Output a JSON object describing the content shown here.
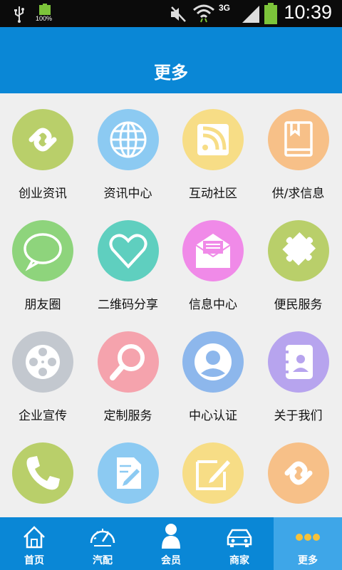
{
  "statusbar": {
    "time": "10:39",
    "battery_percent_label": "100%",
    "network_label": "3G",
    "icons": [
      "usb-icon",
      "battery-icon",
      "mute-icon",
      "wifi-icon",
      "signal-icon",
      "battery-icon"
    ]
  },
  "header": {
    "title": "更多"
  },
  "grid": {
    "items": [
      {
        "label": "创业资讯",
        "icon": "link-icon",
        "color": "#b9cf6a"
      },
      {
        "label": "资讯中心",
        "icon": "globe-icon",
        "color": "#8ccaf2"
      },
      {
        "label": "互动社区",
        "icon": "rss-icon",
        "color": "#f7dd86"
      },
      {
        "label": "供/求信息",
        "icon": "book-icon",
        "color": "#f7c088"
      },
      {
        "label": "朋友圈",
        "icon": "chat-icon",
        "color": "#8ed47c"
      },
      {
        "label": "二维码分享",
        "icon": "heart-icon",
        "color": "#5fcfbf"
      },
      {
        "label": "信息中心",
        "icon": "mail-icon",
        "color": "#f08ae8"
      },
      {
        "label": "便民服务",
        "icon": "puzzle-icon",
        "color": "#b9cf6a"
      },
      {
        "label": "企业宣传",
        "icon": "film-reel-icon",
        "color": "#c3c8cf"
      },
      {
        "label": "定制服务",
        "icon": "magnifier-icon",
        "color": "#f5a3ad"
      },
      {
        "label": "中心认证",
        "icon": "user-icon",
        "color": "#8db7ec"
      },
      {
        "label": "关于我们",
        "icon": "contacts-icon",
        "color": "#b7a4ee"
      },
      {
        "label": "",
        "icon": "phone-icon",
        "color": "#b9cf6a"
      },
      {
        "label": "",
        "icon": "document-edit-icon",
        "color": "#8ccaf2"
      },
      {
        "label": "",
        "icon": "note-edit-icon",
        "color": "#f7dd86"
      },
      {
        "label": "",
        "icon": "link-icon",
        "color": "#f7c088"
      }
    ]
  },
  "tabbar": {
    "tabs": [
      {
        "label": "首页",
        "icon": "home-icon",
        "active": false
      },
      {
        "label": "汽配",
        "icon": "speedometer-icon",
        "active": false
      },
      {
        "label": "会员",
        "icon": "member-icon",
        "active": false
      },
      {
        "label": "商家",
        "icon": "car-icon",
        "active": false
      },
      {
        "label": "更多",
        "icon": "more-dots-icon",
        "active": true
      }
    ]
  },
  "colors": {
    "header": "#0a87d6",
    "tab_active": "#3ea6e8",
    "background": "#efefef"
  }
}
